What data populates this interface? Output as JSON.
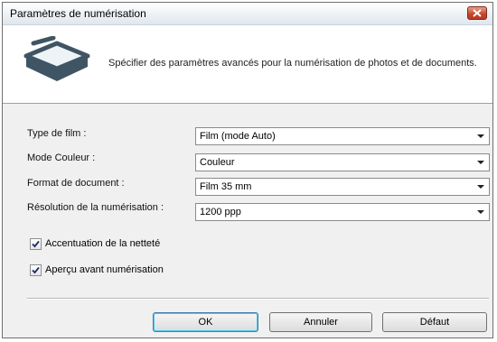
{
  "window": {
    "title": "Paramètres de numérisation"
  },
  "header": {
    "icon": "scanner-icon",
    "description": "Spécifier des paramètres avancés pour la numérisation de photos et de documents."
  },
  "form": {
    "film_type": {
      "label": "Type de film :",
      "value": "Film (mode Auto)"
    },
    "color_mode": {
      "label": "Mode Couleur :",
      "value": "Couleur"
    },
    "document_format": {
      "label": "Format de document :",
      "value": "Film 35 mm"
    },
    "scan_resolution": {
      "label": "Résolution de la numérisation :",
      "value": "1200 ppp"
    }
  },
  "checkboxes": {
    "sharpness": {
      "label": "Accentuation de la netteté",
      "checked": true
    },
    "preview": {
      "label": "Aperçu avant numérisation",
      "checked": true
    }
  },
  "buttons": {
    "ok": "OK",
    "cancel": "Annuler",
    "default": "Défaut"
  },
  "colors": {
    "close_button": "#c7452a",
    "default_button_focus": "#48c8f0"
  }
}
